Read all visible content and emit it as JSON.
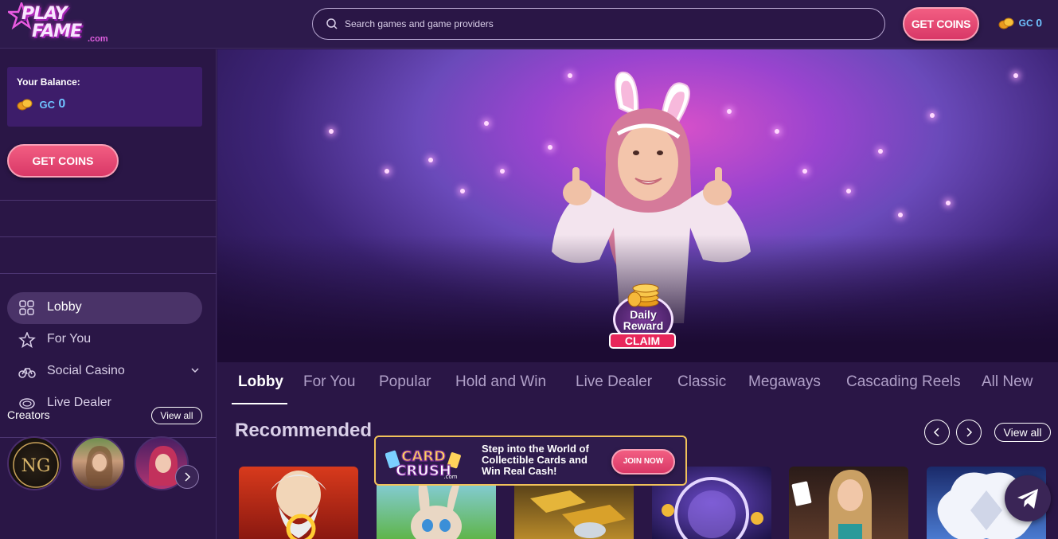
{
  "header": {
    "logo_top": "PLAY",
    "logo_bottom": "FAME",
    "logo_suffix": ".com",
    "search_placeholder": "Search games and game providers",
    "get_coins_label": "GET COINS",
    "balance_currency": "GC",
    "balance_value": "0"
  },
  "sidebar": {
    "balance_label": "Your Balance:",
    "balance_currency": "GC",
    "balance_value": "0",
    "get_coins_label": "GET COINS",
    "nav": [
      {
        "label": "Lobby",
        "icon": "grid-icon",
        "active": true
      },
      {
        "label": "For You",
        "icon": "star-icon",
        "active": false
      },
      {
        "label": "Social Casino",
        "icon": "bicycle-icon",
        "active": false
      },
      {
        "label": "Live Dealer",
        "icon": "table-icon",
        "active": false
      }
    ],
    "creators_label": "Creators",
    "creators_view_all": "View all"
  },
  "banner": {
    "reward_line1": "Daily",
    "reward_line2": "Reward",
    "reward_claim": "CLAIM"
  },
  "tabs": [
    "Lobby",
    "For You",
    "Popular",
    "Hold and Win",
    "Live Dealer",
    "Classic",
    "Megaways",
    "Cascading Reels",
    "All New"
  ],
  "recommended": {
    "title": "Recommended",
    "view_all": "View all"
  },
  "promo": {
    "logo_top": "CARD",
    "logo_bottom": "CRUSH",
    "logo_suffix": ".com",
    "text": "Step into the World of Collectible Cards and Win Real Cash!",
    "button": "JOIN NOW"
  },
  "colors": {
    "accent": "#e8426f",
    "background": "#2a1646",
    "balance_blue": "#6fc3ff"
  }
}
